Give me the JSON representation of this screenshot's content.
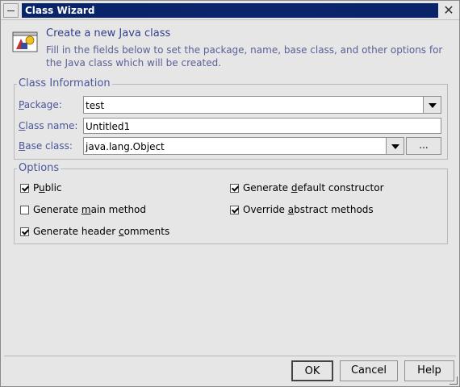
{
  "window": {
    "title": "Class Wizard"
  },
  "header": {
    "title": "Create a new Java class",
    "description": "Fill in the fields below to set the package, name, base class, and other options for the Java class which will be created.",
    "icon": "class-wizard-icon"
  },
  "class_info": {
    "group_label": "Class Information",
    "package_label_first": "P",
    "package_label_rest": "ackage:",
    "package_value": "test",
    "class_name_label_first": "C",
    "class_name_label_rest": "lass name:",
    "class_name_value": "Untitled1",
    "base_class_label_first": "B",
    "base_class_label_rest": "ase class:",
    "base_class_value": "java.lang.Object",
    "browse_label": "..."
  },
  "options": {
    "group_label": "Options",
    "items": [
      {
        "pre": "P",
        "ul": "u",
        "post": "blic",
        "checked": true
      },
      {
        "pre": "Generate ",
        "ul": "d",
        "post": "efault constructor",
        "checked": true
      },
      {
        "pre": "Generate ",
        "ul": "m",
        "post": "ain method",
        "checked": false
      },
      {
        "pre": "Override ",
        "ul": "a",
        "post": "bstract methods",
        "checked": true
      },
      {
        "pre": "Generate header ",
        "ul": "c",
        "post": "omments",
        "checked": true
      }
    ]
  },
  "buttons": {
    "ok": "OK",
    "cancel": "Cancel",
    "help": "Help"
  },
  "colors": {
    "title_bar": "#0a246a",
    "label_text": "#4b5599",
    "header_title": "#323f8c"
  }
}
